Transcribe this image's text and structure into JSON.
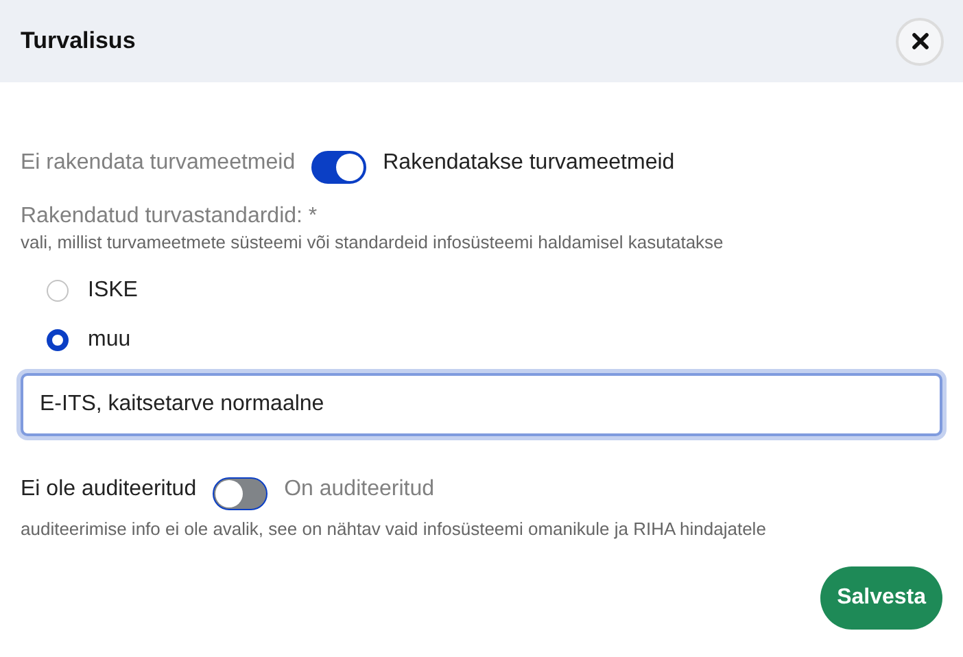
{
  "dialog": {
    "title": "Turvalisus"
  },
  "security_toggle": {
    "off_label": "Ei rakendata turvameetmeid",
    "on_label": "Rakendatakse turvameetmeid",
    "on": true
  },
  "standards": {
    "label": "Rakendatud turvastandardid: *",
    "hint": "vali, millist turvameetmete süsteemi või standardeid infosüsteemi haldamisel kasutatakse",
    "options": [
      {
        "label": "ISKE",
        "selected": false
      },
      {
        "label": "muu",
        "selected": true
      }
    ],
    "other_value": "E-ITS, kaitsetarve normaalne"
  },
  "audit_toggle": {
    "off_label": "Ei ole auditeeritud",
    "on_label": "On auditeeritud",
    "on": false
  },
  "audit_hint": "auditeerimise info ei ole avalik, see on nähtav vaid infosüsteemi omanikule ja RIHA hindajatele",
  "save_button": "Salvesta"
}
